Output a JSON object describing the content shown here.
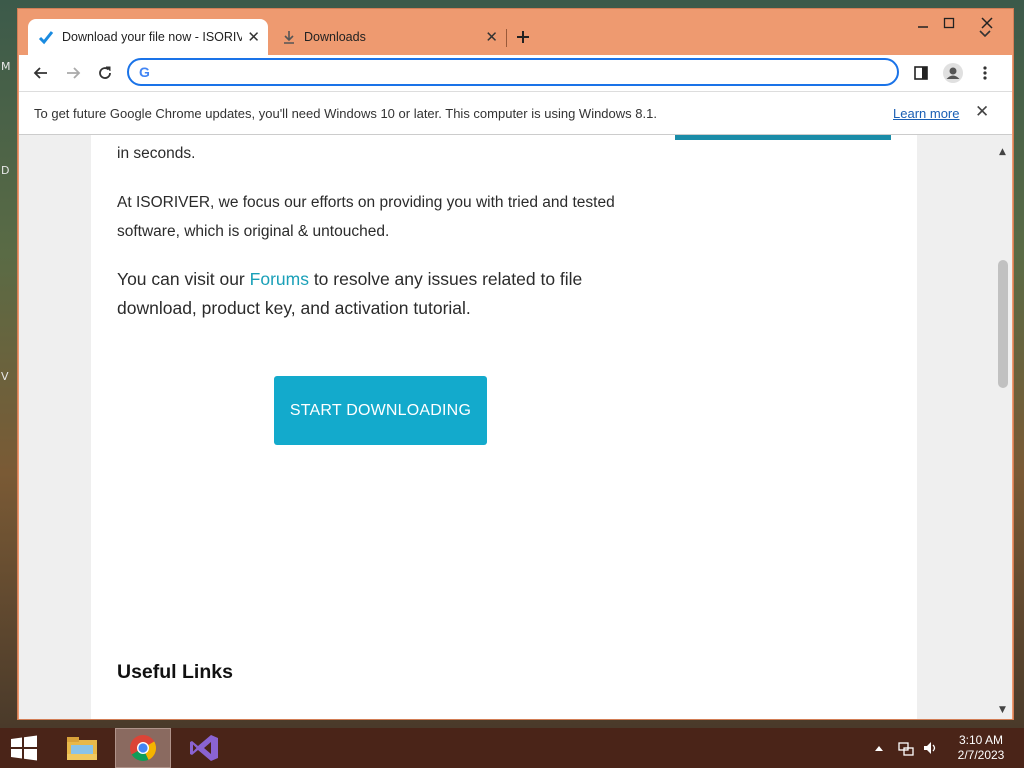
{
  "desktop": {
    "edge_letters": [
      "M",
      "D",
      "V"
    ]
  },
  "browser": {
    "tabs": [
      {
        "title": "Download your file now - ISORIVER",
        "icon": "checkmark-favicon"
      },
      {
        "title": "Downloads",
        "icon": "download-icon"
      }
    ],
    "address": {
      "value": "",
      "icon": "google-icon"
    },
    "infobar": {
      "message": "To get future Google Chrome updates, you'll need Windows 10 or later. This computer is using Windows 8.1.",
      "link": "Learn more"
    }
  },
  "page": {
    "p1": "in seconds.",
    "p2": "At ISORIVER, we focus our efforts on providing you with tried and tested software, which is original & untouched.",
    "p3_before": "You can visit our ",
    "p3_link": "Forums",
    "p3_after": " to resolve any issues related to file download, product key, and activation tutorial.",
    "button": "START DOWNLOADING",
    "useful_links": "Useful Links"
  },
  "taskbar": {
    "time": "3:10 AM",
    "date": "2/7/2023",
    "colors": {
      "bar": "#4a2418",
      "accent": "#13aacc"
    }
  }
}
